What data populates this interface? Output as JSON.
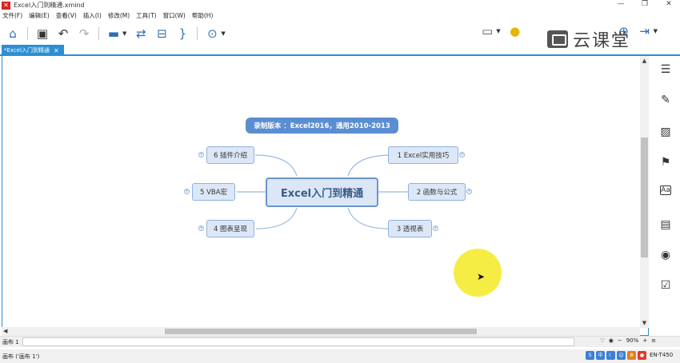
{
  "window": {
    "title": "Excel入门到精通.xmind",
    "logo": "✕"
  },
  "menu": {
    "items": [
      "文件(F)",
      "编辑(E)",
      "查看(V)",
      "插入(I)",
      "修改(M)",
      "工具(T)",
      "窗口(W)",
      "帮助(H)"
    ]
  },
  "brand": {
    "text": "云课堂"
  },
  "tab": {
    "label": "*Excel入门到精通",
    "close": "✕"
  },
  "mindmap": {
    "floating_topic": "录制版本 ：Excel2016，通用2010-2013",
    "central_topic": "Excel入门到精通",
    "topics": [
      {
        "label": "1 Excel实用技巧",
        "side": "right"
      },
      {
        "label": "2 函数与公式",
        "side": "right"
      },
      {
        "label": "3 透视表",
        "side": "right"
      },
      {
        "label": "4 图表呈现",
        "side": "left"
      },
      {
        "label": "5 VBA宏",
        "side": "left"
      },
      {
        "label": "6 插件介绍",
        "side": "left"
      }
    ],
    "expander_symbol": "+"
  },
  "statusbar": {
    "sheet": "画布 1",
    "zoom": "90%",
    "zoom_out": "−",
    "zoom_in": "+",
    "bottom_text": "画布 ('画布 1')",
    "tray_text": "EN-T450"
  }
}
